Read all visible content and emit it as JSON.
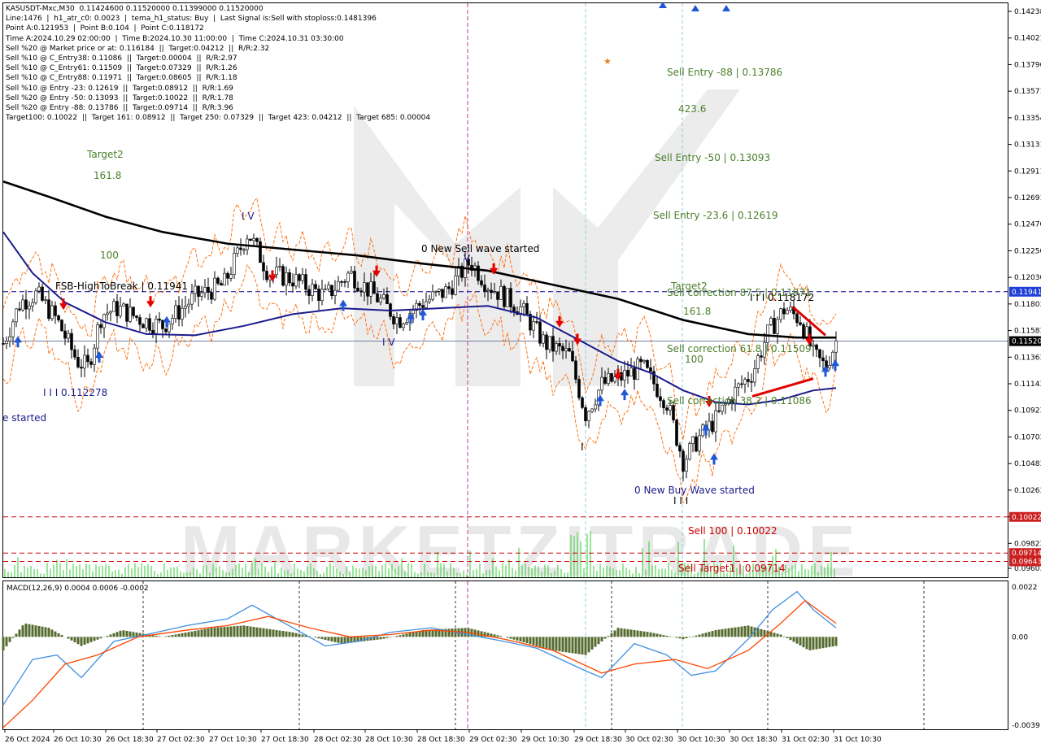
{
  "header": {
    "lines": [
      "KASUSDT-Mxc,M30  0.11424600 0.11520000 0.11399000 0.11520000",
      "Line:1476  |  h1_atr_c0: 0.0023  |  tema_h1_status: Buy  |  Last Signal is:Sell with stoploss:0.1481396",
      "Point A:0.121953  |  Point B:0.104  |  Point C:0.118172",
      "Time A:2024.10.29 02:00:00  |  Time B:2024.10.30 11:00:00  |  Time C:2024.10.31 03:30:00",
      "Sell %20 @ Market price or at: 0.116184  ||  Target:0.04212  ||  R/R:2.32",
      "Sell %10 @ C_Entry38: 0.11086  ||  Target:0.00004  ||  R/R:2.97",
      "Sell %10 @ C_Entry61: 0.11509  ||  Target:0.07329  ||  R/R:1.26",
      "Sell %10 @ C_Entry88: 0.11971  ||  Target:0.08605  ||  R/R:1.18",
      "Sell %10 @ Entry -23: 0.12619  ||  Target:0.08912  ||  R/R:1.69",
      "Sell %20 @ Entry -50: 0.13093  ||  Target:0.10022  ||  R/R:1.78",
      "Sell %20 @ Entry -88: 0.13786  ||  Target:0.09714  ||  R/R:3.96",
      "Target100: 0.10022  ||  Target 161: 0.08912  ||  Target 250: 0.07329  ||  Target 423: 0.04212  ||  Target 685: 0.00004"
    ]
  },
  "colors": {
    "background": "#ffffff",
    "grid": "#c0c0c0",
    "ma_black": "#000000",
    "ma_blue": "#1a1a8c",
    "channel": "#ff6600",
    "volume": "#33cc33",
    "sell_arrow": "#e60000",
    "buy_arrow": "#1f57d6",
    "macd_hist": "#556b2f",
    "macd_line": "#3f8fe0",
    "signal_line": "#ff4500",
    "target_green": "#4b7f2a",
    "dashed_red": "#cc0000",
    "dashed_blue": "#00008b",
    "price_tag_blue": "#1f3fd6",
    "price_tag_red": "#cc2020",
    "watermark": "#d6d6d6"
  },
  "chart_data": [
    {
      "type": "candlestick",
      "title": "KASUSDT-Mxc,M30",
      "y_axis_ticks": [
        "0.14238",
        "0.14021",
        "0.13796",
        "0.13571",
        "0.13354",
        "0.13131",
        "0.12911",
        "0.12691",
        "0.12470",
        "0.12250",
        "0.12030",
        "0.11803",
        "0.11583",
        "0.11363",
        "0.11143",
        "0.10923",
        "0.10703",
        "0.10483",
        "0.10263",
        "0.10043",
        "0.09823",
        "0.09603"
      ],
      "ylim": [
        0.0957,
        0.1433
      ],
      "x_axis_ticks": [
        "26 Oct 2024",
        "26 Oct 10:30",
        "26 Oct 18:30",
        "27 Oct 02:30",
        "27 Oct 10:30",
        "27 Oct 18:30",
        "28 Oct 02:30",
        "28 Oct 10:30",
        "28 Oct 18:30",
        "29 Oct 02:30",
        "29 Oct 10:30",
        "29 Oct 18:30",
        "30 Oct 02:30",
        "30 Oct 10:30",
        "30 Oct 18:30",
        "31 Oct 02:30",
        "31 Oct 10:30"
      ],
      "price_tags": [
        {
          "label": "0.11941",
          "value": 0.11941,
          "color": "#1f3fd6"
        },
        {
          "label": "0.11520",
          "value": 0.1152,
          "color": "#000000"
        },
        {
          "label": "0.10022",
          "value": 0.10022,
          "color": "#cc2020"
        },
        {
          "label": "0.09714",
          "value": 0.09714,
          "color": "#cc2020"
        },
        {
          "label": "0.09643",
          "value": 0.09643,
          "color": "#cc2020"
        }
      ],
      "horizontal_lines": [
        {
          "name": "fsb-high",
          "value": 0.11941,
          "style": "dashed",
          "color": "#00008b"
        },
        {
          "name": "last-price",
          "value": 0.1152,
          "style": "solid",
          "color": "#6f7fa0"
        },
        {
          "name": "sell-100",
          "value": 0.10022,
          "style": "dashed",
          "color": "#cc0000"
        },
        {
          "name": "sell-target1",
          "value": 0.09714,
          "style": "dashed",
          "color": "#cc0000"
        },
        {
          "name": "low-line",
          "value": 0.09643,
          "style": "dashed",
          "color": "#cc0000"
        }
      ],
      "annotations": [
        {
          "text": "Target2",
          "color": "#4b7f2a"
        },
        {
          "text": "161.8",
          "color": "#4b7f2a"
        },
        {
          "text": "100",
          "color": "#4b7f2a"
        },
        {
          "text": "I V",
          "color": "#1a1a8c"
        },
        {
          "text": "FSB-HighToBreak | 0.11941",
          "color": "#000000"
        },
        {
          "text": "I I I 0.112278",
          "color": "#1a1a8c"
        },
        {
          "text": "e started",
          "color": "#1a1a8c"
        },
        {
          "text": "0 New Sell wave started",
          "color": "#000000"
        },
        {
          "text": "V",
          "color": "#1a1a8c"
        },
        {
          "text": "I V",
          "color": "#1a1a8c"
        },
        {
          "text": "Sell Entry -88 | 0.13786",
          "color": "#4b7f2a"
        },
        {
          "text": "423.6",
          "color": "#4b7f2a"
        },
        {
          "text": "Sell Entry -50 | 0.13093",
          "color": "#4b7f2a"
        },
        {
          "text": "Sell Entry -23.6 | 0.12619",
          "color": "#4b7f2a"
        },
        {
          "text": "Target2",
          "color": "#4b7f2a"
        },
        {
          "text": "Sell correction 87.5 | 0.11971",
          "color": "#4b7f2a"
        },
        {
          "text": "161.8",
          "color": "#4b7f2a"
        },
        {
          "text": "I I I 0.118172",
          "color": "#000000"
        },
        {
          "text": "Sell correction 61.8 | 0.11509",
          "color": "#4b7f2a"
        },
        {
          "text": "100",
          "color": "#4b7f2a"
        },
        {
          "text": "Sell correction 38.2 | 0.11086",
          "color": "#4b7f2a"
        },
        {
          "text": "0 New Buy Wave started",
          "color": "#1a1a8c"
        },
        {
          "text": "I I I",
          "color": "#000000"
        },
        {
          "text": "I",
          "color": "#000000"
        },
        {
          "text": "Sell 100 | 0.10022",
          "color": "#cc0000"
        },
        {
          "text": "Sell Target1 | 0.09714",
          "color": "#cc0000"
        }
      ]
    },
    {
      "type": "line",
      "title": "MACD(12,26,9) 0.0004 0.0006 -0.0002",
      "y_axis_ticks": [
        "0.0022",
        "0.00",
        "-0.0039"
      ],
      "ylim": [
        -0.0039,
        0.0022
      ]
    }
  ],
  "watermark": "MARKETZITRADE"
}
